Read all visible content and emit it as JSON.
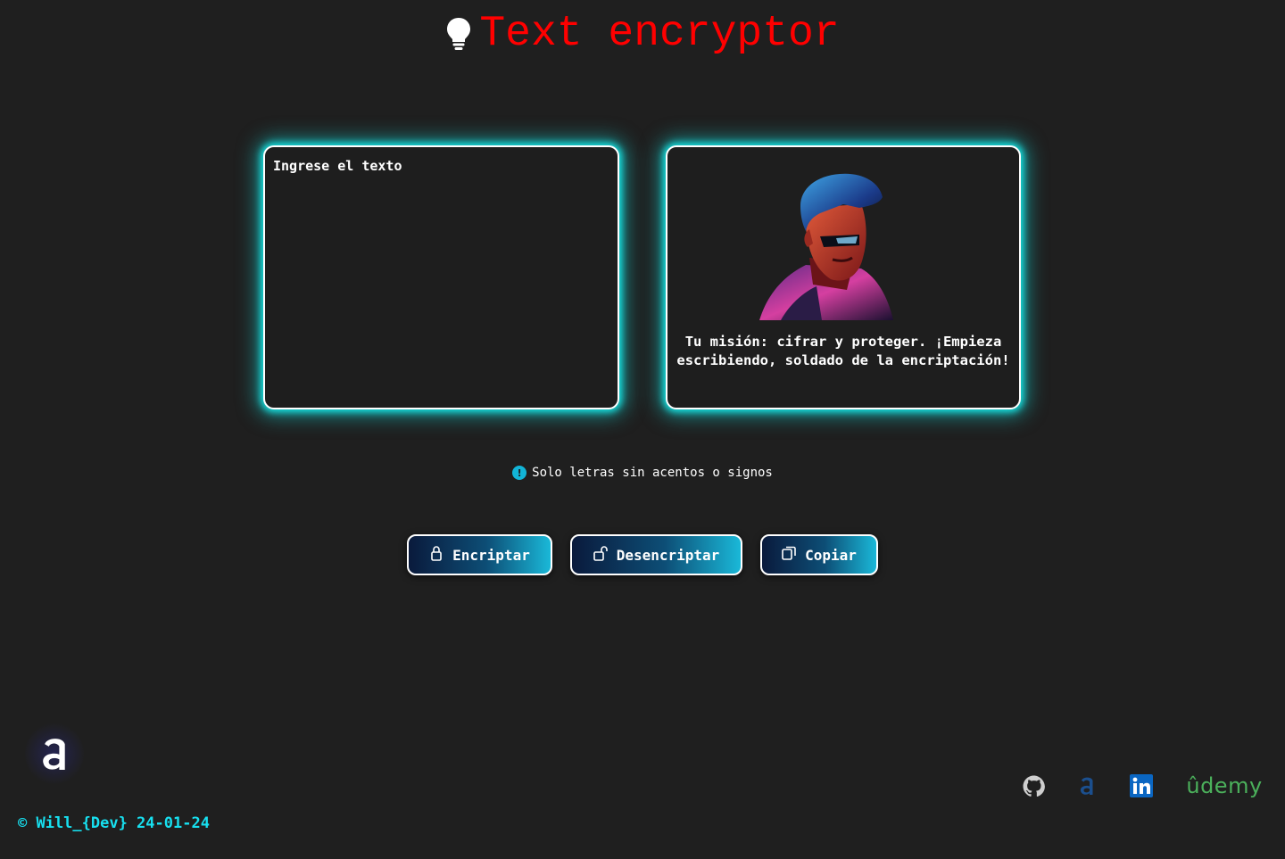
{
  "header": {
    "title": "Text encryptor",
    "icon": "lightbulb-icon"
  },
  "input": {
    "placeholder": "Ingrese el texto"
  },
  "output": {
    "image": "cyborg-soldier-portrait",
    "message": "Tu misión: cifrar y proteger. ¡Empieza escribiendo, soldado de la encriptación!"
  },
  "note": {
    "icon": "info-icon",
    "text": "Solo letras sin acentos o signos"
  },
  "actions": {
    "encrypt_label": "Encriptar",
    "decrypt_label": "Desencriptar",
    "copy_label": "Copiar"
  },
  "footer": {
    "copyright": "© Will_{Dev} 24-01-24",
    "social": [
      "github-icon",
      "alura-icon",
      "linkedin-icon",
      "udemy-icon"
    ]
  },
  "colors": {
    "background": "#1f1f1f",
    "title": "#ff0000",
    "glow": "#16e0e0",
    "footer": "#17e0f0",
    "udemy": "#4bb05b",
    "linkedin": "#0a66c2"
  }
}
